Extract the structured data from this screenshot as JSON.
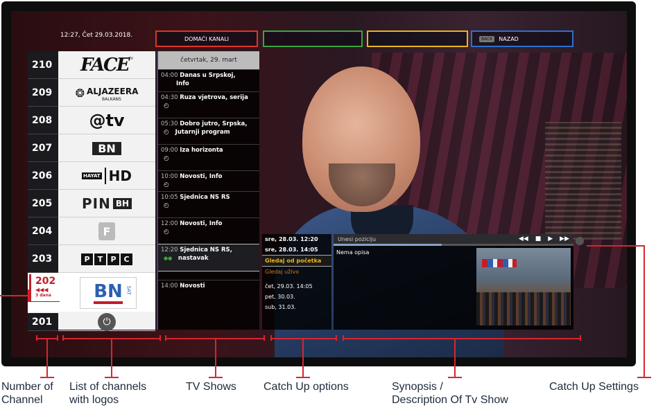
{
  "header": {
    "datetime": "12:27, Čet 29.03.2018.",
    "buttons": {
      "red": "DOMAĆI KANALI",
      "green": "",
      "yellow": "",
      "blue_key": "BACK",
      "blue": "NAZAD"
    }
  },
  "channels": [
    {
      "number": "210",
      "logo": "FACE",
      "logo_sup": "TV"
    },
    {
      "number": "209",
      "logo": "ALJAZEERA",
      "logo_sub": "BALKANS"
    },
    {
      "number": "208",
      "logo": "@tv"
    },
    {
      "number": "207",
      "logo": "BN"
    },
    {
      "number": "206",
      "logo": "HAYAT",
      "logo_suffix": "HD"
    },
    {
      "number": "205",
      "logo": "PIN",
      "logo_suffix": "BH"
    },
    {
      "number": "204",
      "logo": "F"
    },
    {
      "number": "203",
      "logo": [
        "P",
        "T",
        "P",
        "C"
      ]
    },
    {
      "number": "202",
      "logo": "BN",
      "logo_suffix": "SAT",
      "catchup_label": "3 dana"
    },
    {
      "number": "201",
      "logo": "⏻"
    }
  ],
  "programs": {
    "date": "četvrtak, 29. mart",
    "items": [
      {
        "time": "04:00",
        "title": "Danas u Srpskoj,",
        "title2": "Info"
      },
      {
        "time": "04:30",
        "title": "Ruza vjetrova, serija"
      },
      {
        "time": "05:30",
        "title": "Dobro jutro, Srpska,",
        "title2": "Jutarnji program"
      },
      {
        "time": "09:00",
        "title": "Iza horizonta"
      },
      {
        "time": "10:00",
        "title": "Novosti, Info"
      },
      {
        "time": "10:05",
        "title": "Sjednica NS RS"
      },
      {
        "time": "12:00",
        "title": "Novosti, Info"
      },
      {
        "time": "12:20",
        "title": "Sjednica NS RS,",
        "title2": "nastavak"
      },
      {
        "time": "14:00",
        "title": "Novosti"
      }
    ]
  },
  "catchup": {
    "line1": "sre, 28.03. 12:20",
    "line2": "sre, 28.03. 14:05",
    "watch_from_start": "Gledaj od početka",
    "watch_live": "Gledaj uživo",
    "line3": "čet, 29.03. 14:05",
    "line4": "pet, 30.03.",
    "line5": "sub, 31.03."
  },
  "synopsis": {
    "position_placeholder": "Unesi poziciju",
    "description": "Nema opisa",
    "progress": 0.45
  },
  "annotations": {
    "number": [
      "Number of",
      "Channel"
    ],
    "list": [
      "List of channels",
      "with logos"
    ],
    "shows": [
      "TV Shows"
    ],
    "catchup": [
      "Catch Up options"
    ],
    "synopsis": [
      "Synopsis /",
      "Description Of Tv Show"
    ],
    "settings": [
      "Catch Up Settings"
    ]
  },
  "colors": {
    "red_button": "#d9372b",
    "green_button": "#3aa63f",
    "yellow_button": "#e8b51f",
    "blue_button": "#2f6fd1",
    "annotation": "#d7262e"
  }
}
